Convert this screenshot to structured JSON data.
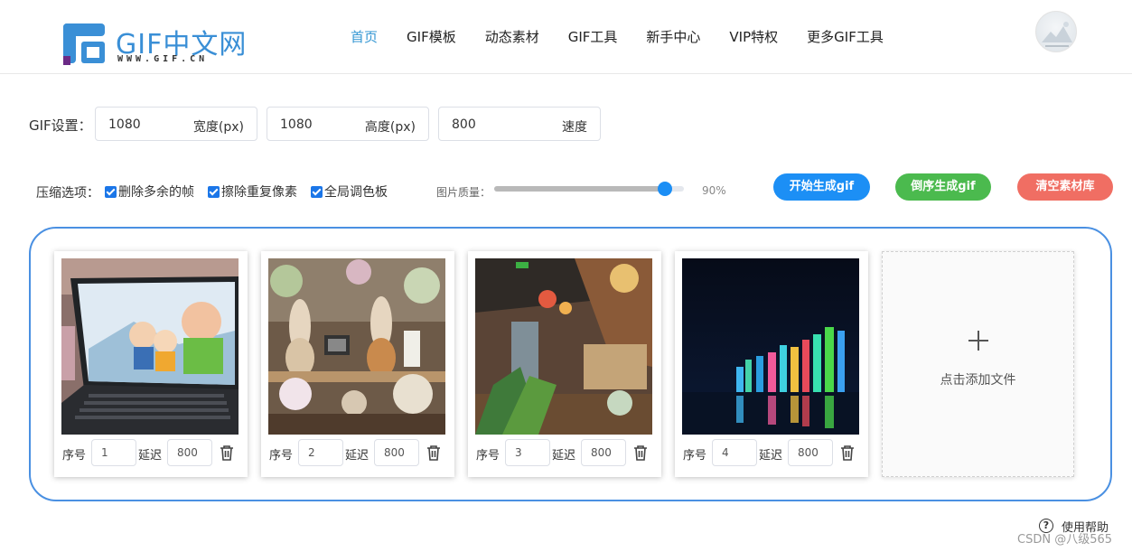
{
  "header": {
    "logo": {
      "text": "GIF中文网",
      "subtitle": "WWW.GIF.CN"
    },
    "nav": [
      "首页",
      "GIF模板",
      "动态素材",
      "GIF工具",
      "新手中心",
      "VIP特权",
      "更多GIF工具"
    ],
    "active_nav": "首页",
    "avatar_icon": "user-avatar-icon"
  },
  "settings": {
    "label": "GIF设置：",
    "width": {
      "value": "1080",
      "unit": "宽度(px)"
    },
    "height": {
      "value": "1080",
      "unit": "高度(px)"
    },
    "speed": {
      "value": "800",
      "unit": "速度"
    }
  },
  "options": {
    "label": "压缩选项：",
    "checkboxes": [
      {
        "label": "删除多余的帧",
        "checked": true
      },
      {
        "label": "擦除重复像素",
        "checked": true
      },
      {
        "label": "全局调色板",
        "checked": true
      }
    ],
    "quality_label": "图片质量：",
    "quality_value": "90%",
    "quality_fraction": 0.9,
    "buttons": {
      "start": "开始生成gif",
      "reverse": "倒序生成gif",
      "clear": "清空素材库"
    },
    "colors": {
      "blue": "#1c8ff5",
      "green": "#4bba4e",
      "red": "#f06e63"
    }
  },
  "frames": {
    "seq_label": "序号",
    "delay_label": "延迟",
    "items": [
      {
        "seq": "1",
        "delay": "800",
        "image": "laptop-anime-photo"
      },
      {
        "seq": "2",
        "delay": "800",
        "image": "rabbit-figures-photo"
      },
      {
        "seq": "3",
        "delay": "800",
        "image": "restaurant-interior-photo"
      },
      {
        "seq": "4",
        "delay": "800",
        "image": "city-night-skyline-photo"
      }
    ],
    "add_label": "点击添加文件"
  },
  "footer": {
    "help_label": "使用帮助",
    "watermark": "CSDN @八级565"
  }
}
